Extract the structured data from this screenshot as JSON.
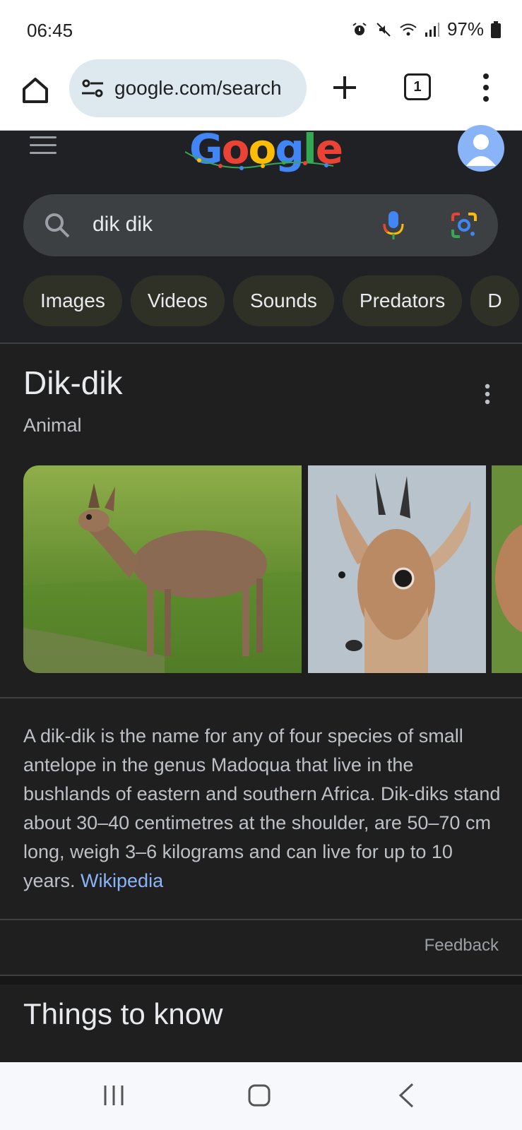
{
  "status_bar": {
    "time": "06:45",
    "battery": "97%",
    "icons": [
      "alarm-icon",
      "mute-icon",
      "wifi-icon",
      "signal-icon",
      "battery-icon"
    ]
  },
  "browser": {
    "url": "google.com/search",
    "tab_count": "1"
  },
  "search": {
    "query": "dik dik",
    "chips": [
      "Images",
      "Videos",
      "Sounds",
      "Predators",
      "D"
    ]
  },
  "knowledge_panel": {
    "title": "Dik-dik",
    "subtitle": "Animal",
    "description": "A dik-dik is the name for any of four species of small antelope in the genus Madoqua that live in the bushlands of eastern and southern Africa. Dik-diks stand about 30–40 centimetres at the shoulder, are 50–70 cm long, weigh 3–6 kilograms and can live for up to 10 years.",
    "source_link": "Wikipedia",
    "feedback": "Feedback"
  },
  "things_to_know": {
    "title": "Things to know"
  },
  "colors": {
    "background": "#1f1f1f",
    "link": "#8ab4f8",
    "chip": "#303126",
    "search_bar": "#3c4043"
  }
}
